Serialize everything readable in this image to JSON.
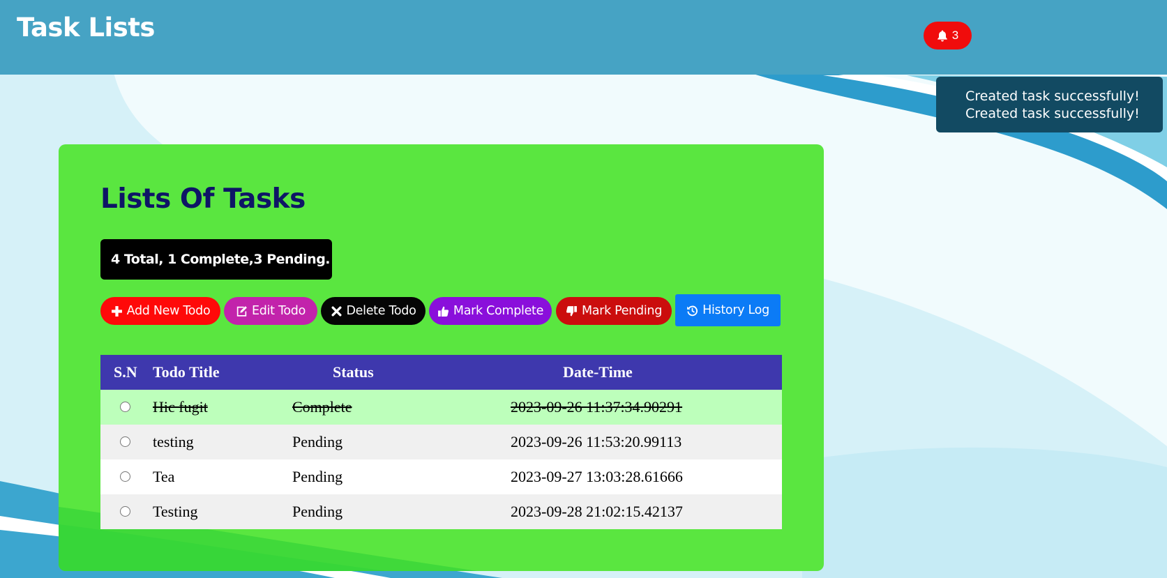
{
  "header": {
    "title": "Task Lists",
    "notification_count": "3"
  },
  "toast": {
    "messages": [
      "Created task successfully!",
      "Created task successfully!"
    ]
  },
  "main": {
    "title": "Lists Of Tasks",
    "summary": "4 Total, 1 Complete,3 Pending."
  },
  "actions": {
    "add": "Add New Todo",
    "edit": "Edit Todo",
    "delete": "Delete Todo",
    "complete": "Mark Complete",
    "pending": "Mark Pending",
    "history": "History Log"
  },
  "table": {
    "columns": [
      "S.N",
      "Todo Title",
      "Status",
      "Date-Time"
    ],
    "rows": [
      {
        "title": "Hic fugit",
        "status": "Complete",
        "datetime": "2023-09-26 11:37:34.90291"
      },
      {
        "title": "testing",
        "status": "Pending",
        "datetime": "2023-09-26 11:53:20.99113"
      },
      {
        "title": "Tea",
        "status": "Pending",
        "datetime": "2023-09-27 13:03:28.61666"
      },
      {
        "title": "Testing",
        "status": "Pending",
        "datetime": "2023-09-28 21:02:15.42137"
      }
    ]
  },
  "colors": {
    "topbar": "#46a3c4",
    "panel": "#5ae640",
    "table_header": "#3e38ad",
    "complete_row": "#bdffbb",
    "badge": "#f00c0c",
    "toast": "#124a62"
  },
  "icons": {
    "notification": "bell-icon",
    "add": "plus-icon",
    "edit": "edit-icon",
    "delete": "close-icon",
    "complete": "thumbs-up-icon",
    "pending": "thumbs-down-icon",
    "history": "history-icon"
  }
}
